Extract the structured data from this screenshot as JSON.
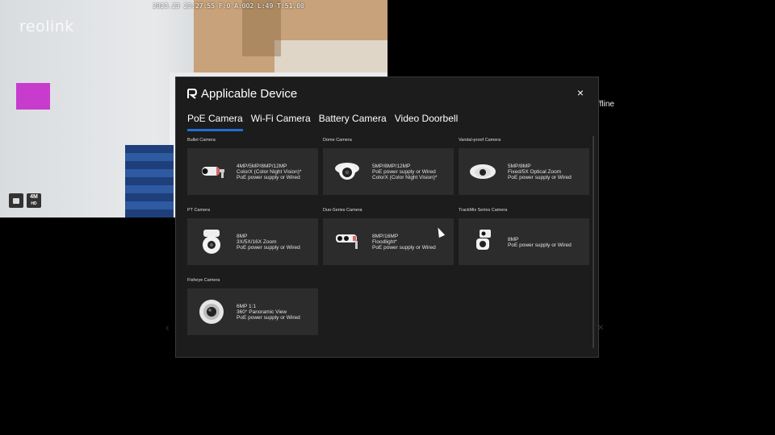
{
  "feed": {
    "osd_text": "2023.23 23:27:55 F:0 A:002 L:49 T:51.00",
    "logo_text": "reolink",
    "resolution_badge": "4M",
    "resolution_sub": "HD"
  },
  "background": {
    "offline_label": "ffline"
  },
  "modal": {
    "title": "Applicable Device",
    "close_glyph": "×",
    "tabs": [
      {
        "label": "PoE Camera",
        "active": true
      },
      {
        "label": "Wi-Fi Camera",
        "active": false
      },
      {
        "label": "Battery Camera",
        "active": false
      },
      {
        "label": "Video Doorbell",
        "active": false
      }
    ],
    "sections": [
      {
        "label": "Bullet Camera",
        "icon": "bullet-camera-icon",
        "specs": [
          "4MP/5MP/8MP/12MP",
          "ColorX (Color Night Vision)*",
          "PoE power supply or Wired"
        ]
      },
      {
        "label": "Dome Camera",
        "icon": "dome-camera-icon",
        "specs": [
          "5MP/8MP/12MP",
          "PoE power supply or Wired",
          "ColorX (Color Night Vision)*"
        ]
      },
      {
        "label": "Vandal-proof Camera",
        "icon": "vandal-proof-camera-icon",
        "specs": [
          "5MP/8MP",
          "Fixed/5X Optical Zoom",
          "PoE power supply or Wired"
        ]
      },
      {
        "label": "PT Camera",
        "icon": "pt-camera-icon",
        "specs": [
          "8MP",
          "3X/5X/16X Zoom",
          "PoE power supply or Wired"
        ]
      },
      {
        "label": "Duo-Series Camera",
        "icon": "duo-camera-icon",
        "specs": [
          "8MP/16MP",
          "Floodlight*",
          "PoE power supply or Wired"
        ]
      },
      {
        "label": "TrackMix Series Camera",
        "icon": "trackmix-camera-icon",
        "specs": [
          "8MP",
          "PoE power supply or Wired"
        ]
      },
      {
        "label": "Fisheye Camera",
        "icon": "fisheye-camera-icon",
        "specs": [
          "6MP 1:1",
          "360° Panoramic View",
          "PoE power supply or Wired"
        ]
      }
    ]
  },
  "colors": {
    "accent": "#1f6fd1",
    "modal_bg": "#1c1c1c",
    "card_bg": "#2c2c2c"
  }
}
